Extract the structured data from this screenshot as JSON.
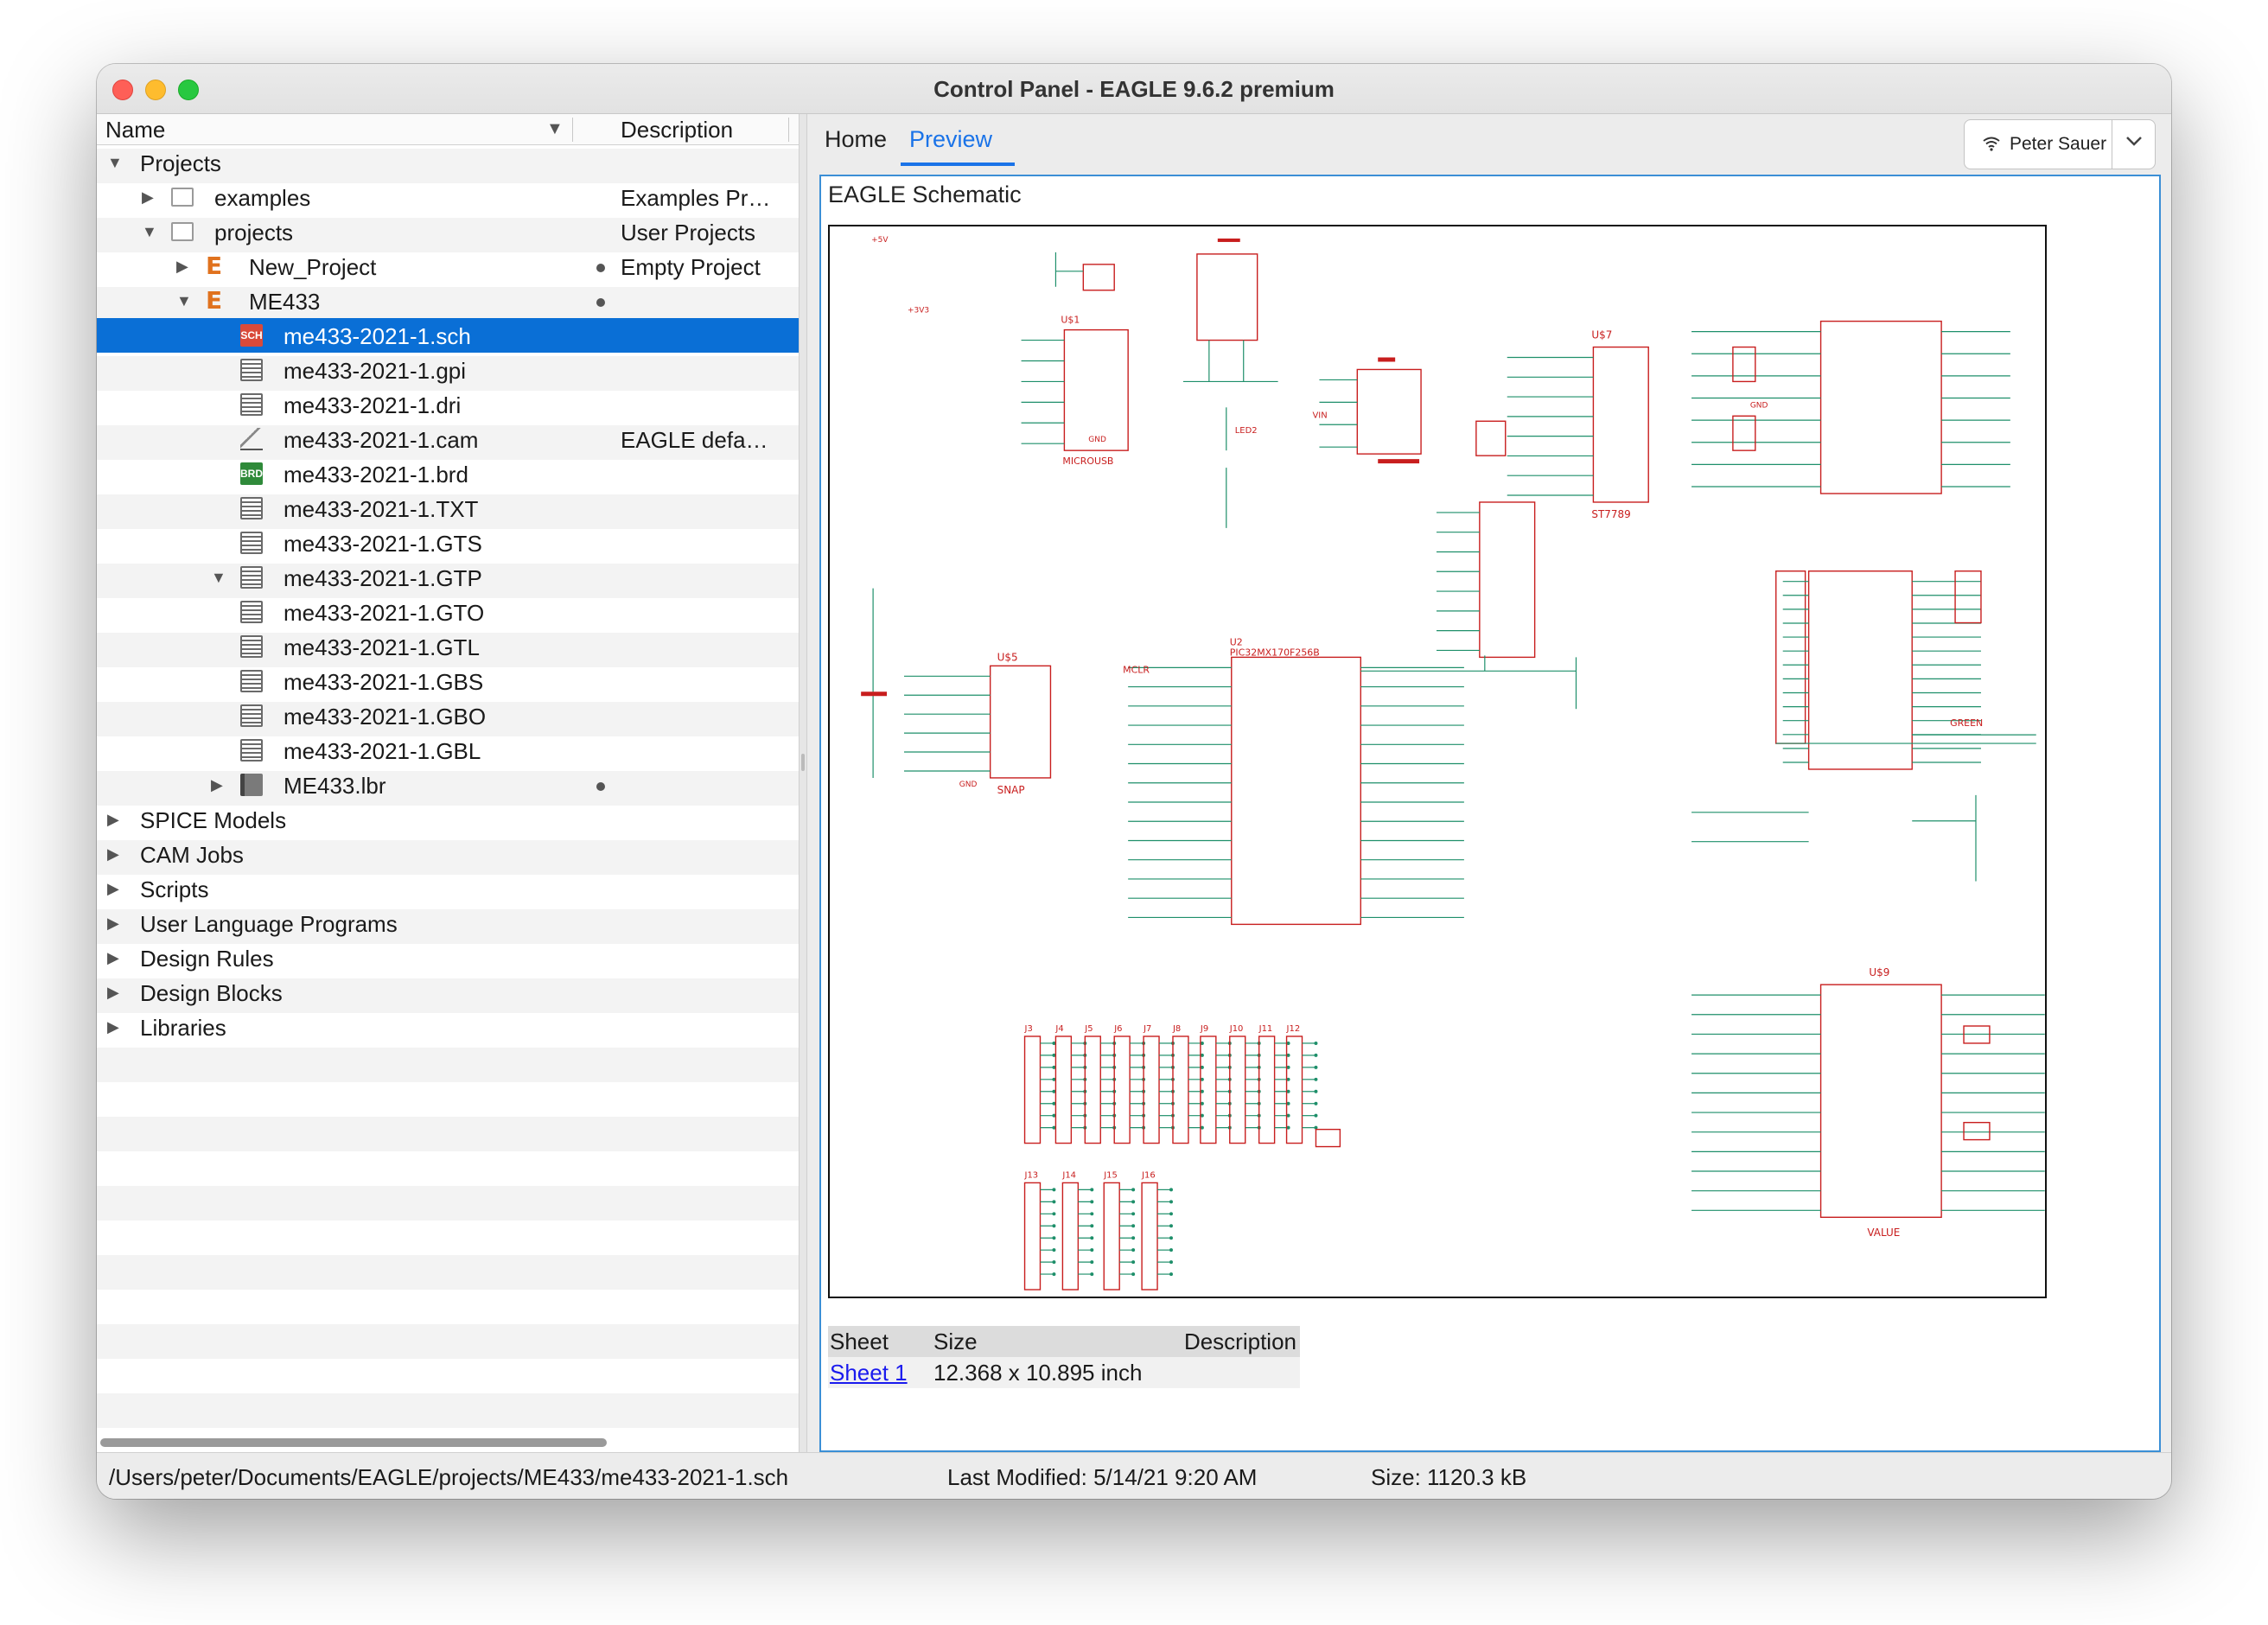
{
  "window": {
    "title": "Control Panel - EAGLE 9.6.2 premium"
  },
  "tree": {
    "col_name": "Name",
    "col_desc": "Description",
    "rows": [
      {
        "label": "Projects",
        "desc": "",
        "toggle": "▼",
        "icon": "",
        "level": 0,
        "dot": false,
        "selected": false
      },
      {
        "label": "examples",
        "desc": "Examples Pr…",
        "toggle": "▶",
        "icon": "folder",
        "level": 1,
        "dot": false,
        "selected": false
      },
      {
        "label": "projects",
        "desc": "User Projects",
        "toggle": "▼",
        "icon": "folder",
        "level": 1,
        "dot": false,
        "selected": false
      },
      {
        "label": "New_Project",
        "desc": "Empty Project",
        "toggle": "▶",
        "icon": "eagle",
        "level": 2,
        "dot": true,
        "selected": false
      },
      {
        "label": "ME433",
        "desc": "",
        "toggle": "▼",
        "icon": "eagle",
        "level": 2,
        "dot": true,
        "selected": false
      },
      {
        "label": "me433-2021-1.sch",
        "desc": "",
        "toggle": "",
        "icon": "sch",
        "level": 3,
        "dot": false,
        "selected": true
      },
      {
        "label": "me433-2021-1.gpi",
        "desc": "",
        "toggle": "",
        "icon": "doc",
        "level": 3,
        "dot": false,
        "selected": false
      },
      {
        "label": "me433-2021-1.dri",
        "desc": "",
        "toggle": "",
        "icon": "doc",
        "level": 3,
        "dot": false,
        "selected": false
      },
      {
        "label": "me433-2021-1.cam",
        "desc": "EAGLE defa…",
        "toggle": "",
        "icon": "cam",
        "level": 3,
        "dot": false,
        "selected": false
      },
      {
        "label": "me433-2021-1.brd",
        "desc": "",
        "toggle": "",
        "icon": "brd",
        "level": 3,
        "dot": false,
        "selected": false
      },
      {
        "label": "me433-2021-1.TXT",
        "desc": "",
        "toggle": "",
        "icon": "doc",
        "level": 3,
        "dot": false,
        "selected": false
      },
      {
        "label": "me433-2021-1.GTS",
        "desc": "",
        "toggle": "",
        "icon": "doc",
        "level": 3,
        "dot": false,
        "selected": false
      },
      {
        "label": "me433-2021-1.GTP",
        "desc": "",
        "toggle": "▼",
        "icon": "doc",
        "level": 3,
        "dot": false,
        "selected": false
      },
      {
        "label": "me433-2021-1.GTO",
        "desc": "",
        "toggle": "",
        "icon": "doc",
        "level": 3,
        "dot": false,
        "selected": false
      },
      {
        "label": "me433-2021-1.GTL",
        "desc": "",
        "toggle": "",
        "icon": "doc",
        "level": 3,
        "dot": false,
        "selected": false
      },
      {
        "label": "me433-2021-1.GBS",
        "desc": "",
        "toggle": "",
        "icon": "doc",
        "level": 3,
        "dot": false,
        "selected": false
      },
      {
        "label": "me433-2021-1.GBO",
        "desc": "",
        "toggle": "",
        "icon": "doc",
        "level": 3,
        "dot": false,
        "selected": false
      },
      {
        "label": "me433-2021-1.GBL",
        "desc": "",
        "toggle": "",
        "icon": "doc",
        "level": 3,
        "dot": false,
        "selected": false
      },
      {
        "label": "ME433.lbr",
        "desc": "",
        "toggle": "▶",
        "icon": "lbr",
        "level": 3,
        "dot": true,
        "selected": false
      },
      {
        "label": "SPICE Models",
        "desc": "",
        "toggle": "▶",
        "icon": "",
        "level": 0,
        "dot": false,
        "selected": false
      },
      {
        "label": "CAM Jobs",
        "desc": "",
        "toggle": "▶",
        "icon": "",
        "level": 0,
        "dot": false,
        "selected": false
      },
      {
        "label": "Scripts",
        "desc": "",
        "toggle": "▶",
        "icon": "",
        "level": 0,
        "dot": false,
        "selected": false
      },
      {
        "label": "User Language Programs",
        "desc": "",
        "toggle": "▶",
        "icon": "",
        "level": 0,
        "dot": false,
        "selected": false
      },
      {
        "label": "Design Rules",
        "desc": "",
        "toggle": "▶",
        "icon": "",
        "level": 0,
        "dot": false,
        "selected": false
      },
      {
        "label": "Design Blocks",
        "desc": "",
        "toggle": "▶",
        "icon": "",
        "level": 0,
        "dot": false,
        "selected": false
      },
      {
        "label": "Libraries",
        "desc": "",
        "toggle": "▶",
        "icon": "",
        "level": 0,
        "dot": false,
        "selected": false
      }
    ]
  },
  "tabs": {
    "home": "Home",
    "preview": "Preview"
  },
  "user": {
    "name": "Peter Sauer",
    "icon": "wifi-icon"
  },
  "preview": {
    "title": "EAGLE Schematic",
    "table": {
      "headers": {
        "sheet": "Sheet",
        "size": "Size",
        "description": "Description"
      },
      "row": {
        "sheet": "Sheet 1",
        "size": "12.368 x 10.895 inch"
      }
    }
  },
  "schematic": {
    "labels": [
      "U$1",
      "MICROUSB",
      "U$5",
      "SNAP",
      "U2",
      "PIC32MX170F256B",
      "U$7",
      "ST7789",
      "U$9",
      "VALUE",
      "GND",
      "VIN",
      "+3V3",
      "+5V",
      "MCLR",
      "LED2",
      "GREEN",
      "GND",
      "J3",
      "J4",
      "J5",
      "J6",
      "J7",
      "J8",
      "J9",
      "J10",
      "J11",
      "J12",
      "J13",
      "J14",
      "J15",
      "J16"
    ],
    "colors": {
      "component": "#c81e1e",
      "wire": "#1e8f6a"
    }
  },
  "status": {
    "path": "/Users/peter/Documents/EAGLE/projects/ME433/me433-2021-1.sch",
    "modified": "Last Modified: 5/14/21 9:20 AM",
    "size": "Size: 1120.3 kB"
  },
  "colors": {
    "accent": "#1a73e8",
    "selection": "#0a6fd6"
  }
}
